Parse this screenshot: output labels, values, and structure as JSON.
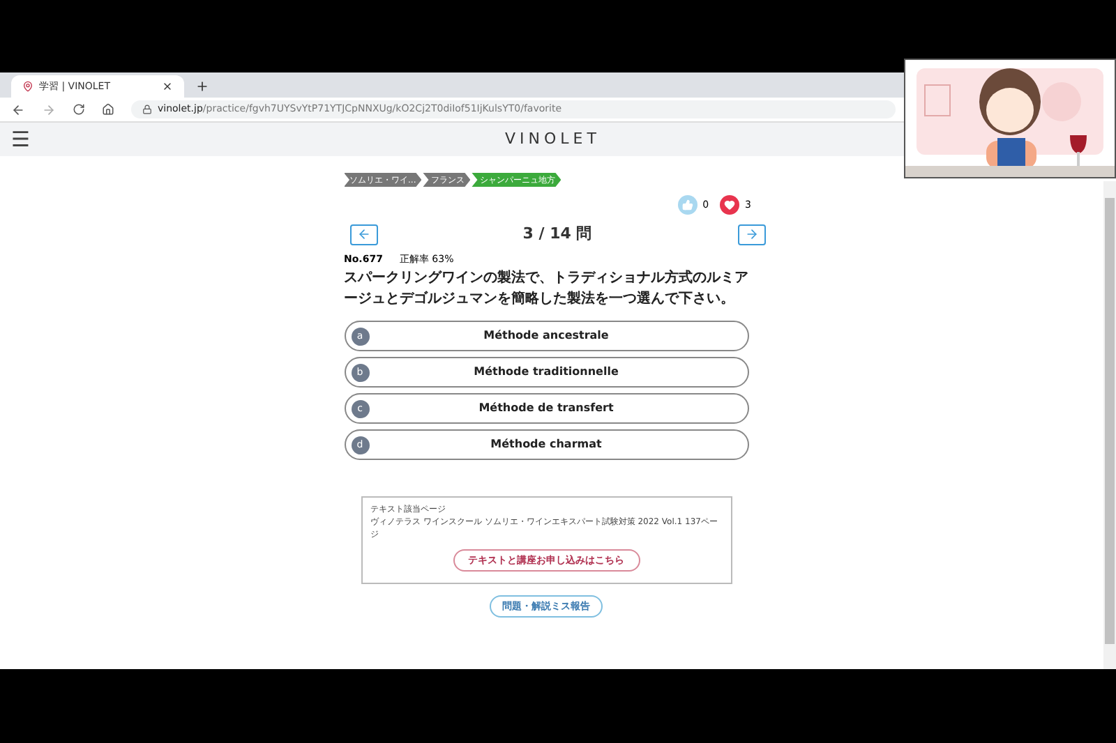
{
  "browser": {
    "tab_title": "学習 | VINOLET",
    "url_host": "vinolet.jp",
    "url_path": "/practice/fgvh7UYSvYtP71YTJCpNNXUg/kO2Cj2T0diIof51IjKulsYT0/favorite"
  },
  "header": {
    "menu": "☰",
    "brand": "VINOLET"
  },
  "breadcrumb": [
    {
      "label": "ソムリエ・ワイ...",
      "current": false
    },
    {
      "label": "フランス",
      "current": false
    },
    {
      "label": "シャンパーニュ地方",
      "current": true
    }
  ],
  "reactions": {
    "likes": "0",
    "favorites": "3",
    "favorited": true
  },
  "counter": "3 / 14 問",
  "question": {
    "number": "No.677",
    "rate": "正解率 63%",
    "text": "スパークリングワインの製法で、トラディショナル方式のルミアージュとデゴルジュマンを簡略した製法を一つ選んで下さい。"
  },
  "options": [
    {
      "letter": "a",
      "text": "Méthode ancestrale",
      "selected": false
    },
    {
      "letter": "b",
      "text": "Méthode traditionnelle",
      "selected": false
    },
    {
      "letter": "c",
      "text": "Méthode de transfert",
      "selected": false
    },
    {
      "letter": "d",
      "text": "Méthode charmat",
      "selected": false
    }
  ],
  "textbook": {
    "label": "テキスト該当ページ",
    "reference": "ヴィノテラス ワインスクール ソムリエ・ワインエキスパート試験対策 2022 Vol.1 137ページ",
    "button": "テキストと講座お申し込みはこちら"
  },
  "report_button": "問題・解説ミス報告"
}
